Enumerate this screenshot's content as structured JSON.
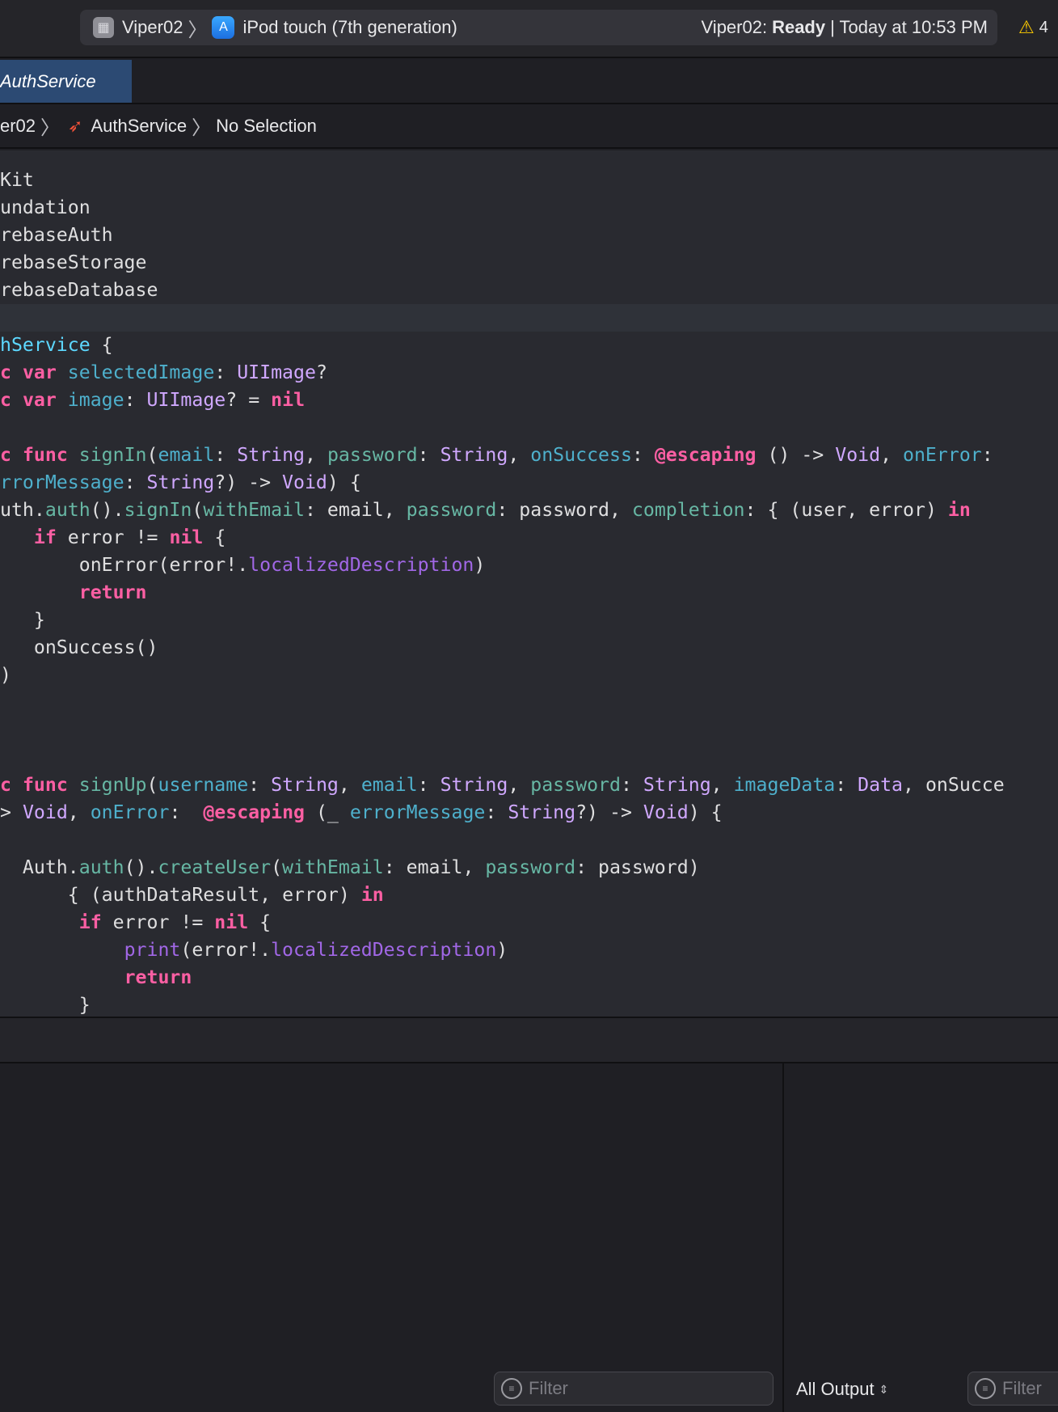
{
  "toolbar": {
    "scheme": "Viper02",
    "destination": "iPod touch (7th generation)",
    "status_project": "Viper02:",
    "status_state": "Ready",
    "status_time": "| Today at 10:53 PM",
    "warning_count": "4"
  },
  "tab": {
    "label": "AuthService"
  },
  "jumpbar": {
    "project": "er02",
    "file": "AuthService",
    "selection": "No Selection"
  },
  "code": {
    "lines": [
      "Kit",
      "undation",
      "rebaseAuth",
      "rebaseStorage",
      "rebaseDatabase",
      "",
      "hService {",
      "c var selectedImage: UIImage?",
      "c var image: UIImage? = nil",
      "",
      "c func signIn(email: String, password: String, onSuccess: @escaping () -> Void, onError:",
      "rrorMessage: String?) -> Void) {",
      "uth.auth().signIn(withEmail: email, password: password, completion: { (user, error) in",
      "   if error != nil {",
      "       onError(error!.localizedDescription)",
      "       return",
      "   }",
      "   onSuccess()",
      ")",
      "",
      "",
      "",
      "c func signUp(username: String, email: String, password: String, imageData: Data, onSucce",
      "> Void, onError:  @escaping (_ errorMessage: String?) -> Void) {",
      "",
      "  Auth.auth().createUser(withEmail: email, password: password)",
      "      { (authDataResult, error) in",
      "       if error != nil {",
      "           print(error!.localizedDescription)",
      "           return",
      "       }"
    ]
  },
  "console": {
    "filter_placeholder_left": "Filter",
    "output_mode": "All Output",
    "filter_placeholder_right": "Filter"
  }
}
